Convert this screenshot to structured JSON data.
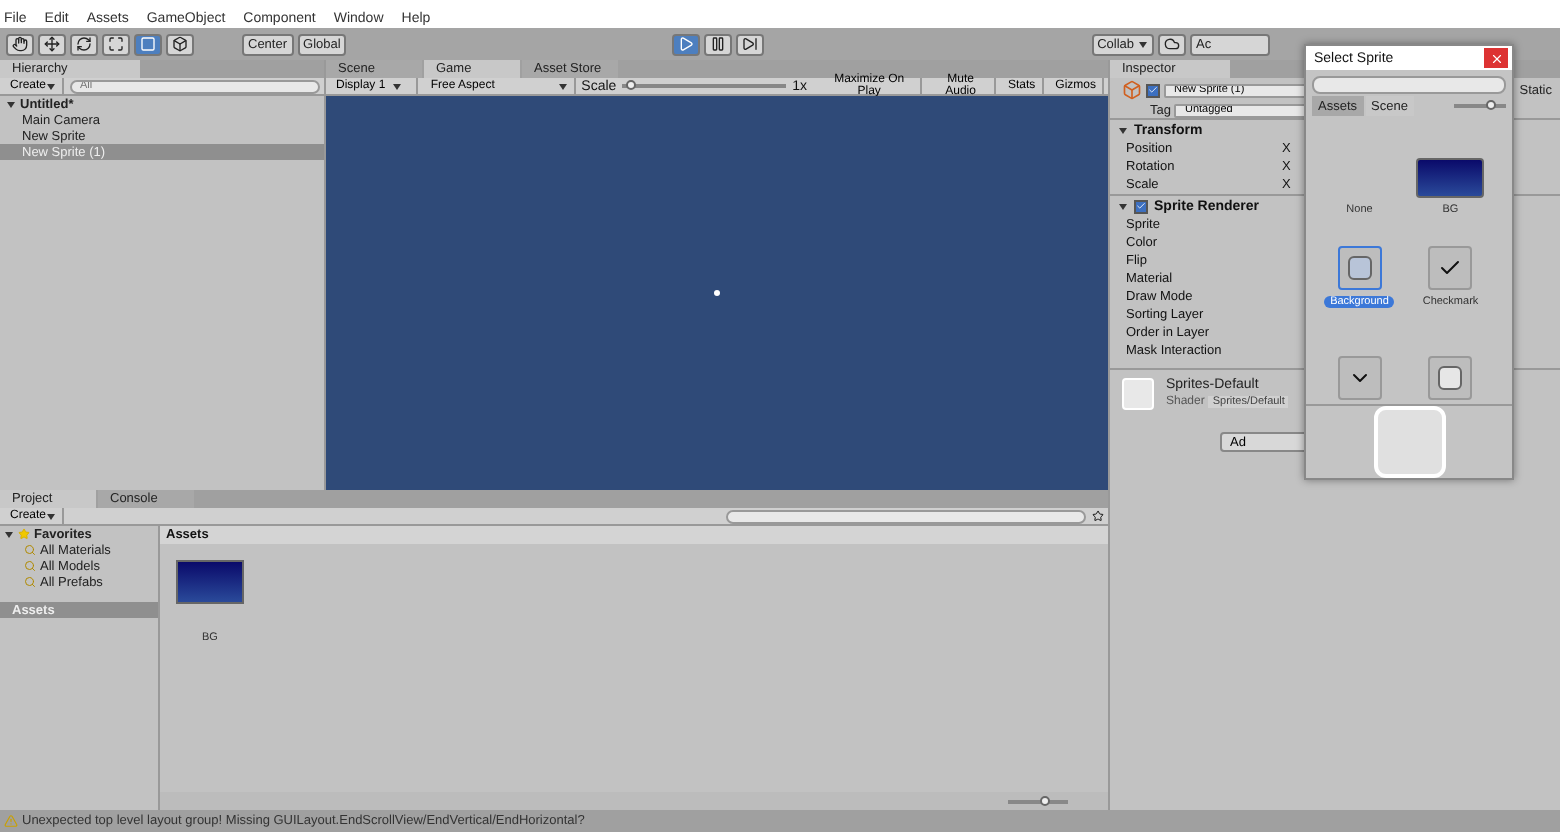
{
  "menu": [
    "File",
    "Edit",
    "Assets",
    "GameObject",
    "Component",
    "Window",
    "Help"
  ],
  "toolbar": {
    "pivot": "Center",
    "space": "Global",
    "playing": true,
    "paused": false,
    "collab": "Collab",
    "account": "Ac"
  },
  "hierarchy": {
    "tab": "Hierarchy",
    "create": "Create",
    "search_placeholder": "All",
    "scene": "Untitled*",
    "items": [
      {
        "label": "Main Camera",
        "selected": false
      },
      {
        "label": "New Sprite",
        "selected": false
      },
      {
        "label": "New Sprite (1)",
        "selected": true
      }
    ]
  },
  "center_tabs": [
    {
      "label": "Scene",
      "selected": false
    },
    {
      "label": "Game",
      "selected": true
    },
    {
      "label": "Asset Store",
      "selected": false
    }
  ],
  "game_bar": {
    "display": "Display 1",
    "aspect": "Free Aspect",
    "scale_label": "Scale",
    "scale": {
      "level": 0.05
    },
    "scale_reading": "1x",
    "buttons": [
      "Maximize On Play",
      "Mute Audio",
      "Stats",
      "Gizmos"
    ]
  },
  "inspector": {
    "tab": "Inspector",
    "active": true,
    "name": "New Sprite (1)",
    "static": "Static",
    "tag_label": "Tag",
    "tag": "Untagged",
    "components": [
      {
        "title": "Transform",
        "expanded": true,
        "fields": [
          {
            "label": "Position",
            "axis": "X"
          },
          {
            "label": "Rotation",
            "axis": "X"
          },
          {
            "label": "Scale",
            "axis": "X"
          }
        ]
      },
      {
        "title": "Sprite Renderer",
        "expanded": true,
        "enabled": true,
        "fields": [
          {
            "label": "Sprite"
          },
          {
            "label": "Color"
          },
          {
            "label": "Flip"
          },
          {
            "label": "Material"
          },
          {
            "label": "Draw Mode"
          },
          {
            "label": "Sorting Layer"
          },
          {
            "label": "Order in Layer"
          },
          {
            "label": "Mask Interaction"
          }
        ]
      }
    ],
    "material": "Sprites-Default",
    "shader_label": "Shader",
    "shader": "Sprites/Default",
    "add_button": "Ad"
  },
  "bottom_tabs": [
    {
      "label": "Project",
      "selected": true
    },
    {
      "label": "Console",
      "selected": false
    }
  ],
  "project": {
    "create": "Create",
    "favorites": {
      "label": "Favorites",
      "expanded": true,
      "children": [
        {
          "label": "All Materials"
        },
        {
          "label": "All Models"
        },
        {
          "label": "All Prefabs"
        }
      ]
    },
    "assets_root": {
      "label": "Assets",
      "selected": true
    },
    "breadcrumb": "Assets",
    "files": [
      {
        "label": "BG"
      }
    ],
    "zoom": {
      "level": 0.6
    }
  },
  "sprite_picker": {
    "title": "Select Sprite",
    "tabs": [
      {
        "label": "Assets",
        "selected": false
      },
      {
        "label": "Scene",
        "selected": true
      }
    ],
    "zoom": {
      "level": 0.7
    },
    "items": [
      {
        "kind": "none",
        "label": "None",
        "selected": false
      },
      {
        "kind": "gradient",
        "label": "BG",
        "selected": false
      },
      {
        "kind": "rounded",
        "label": "Background",
        "selected": true
      },
      {
        "kind": "check",
        "label": "Checkmark",
        "selected": false
      },
      {
        "kind": "chevron",
        "selected": false
      },
      {
        "kind": "knob",
        "selected": false
      }
    ]
  },
  "status": "Unexpected top level layout group! Missing GUILayout.EndScrollView/EndVertical/EndHorizontal?"
}
